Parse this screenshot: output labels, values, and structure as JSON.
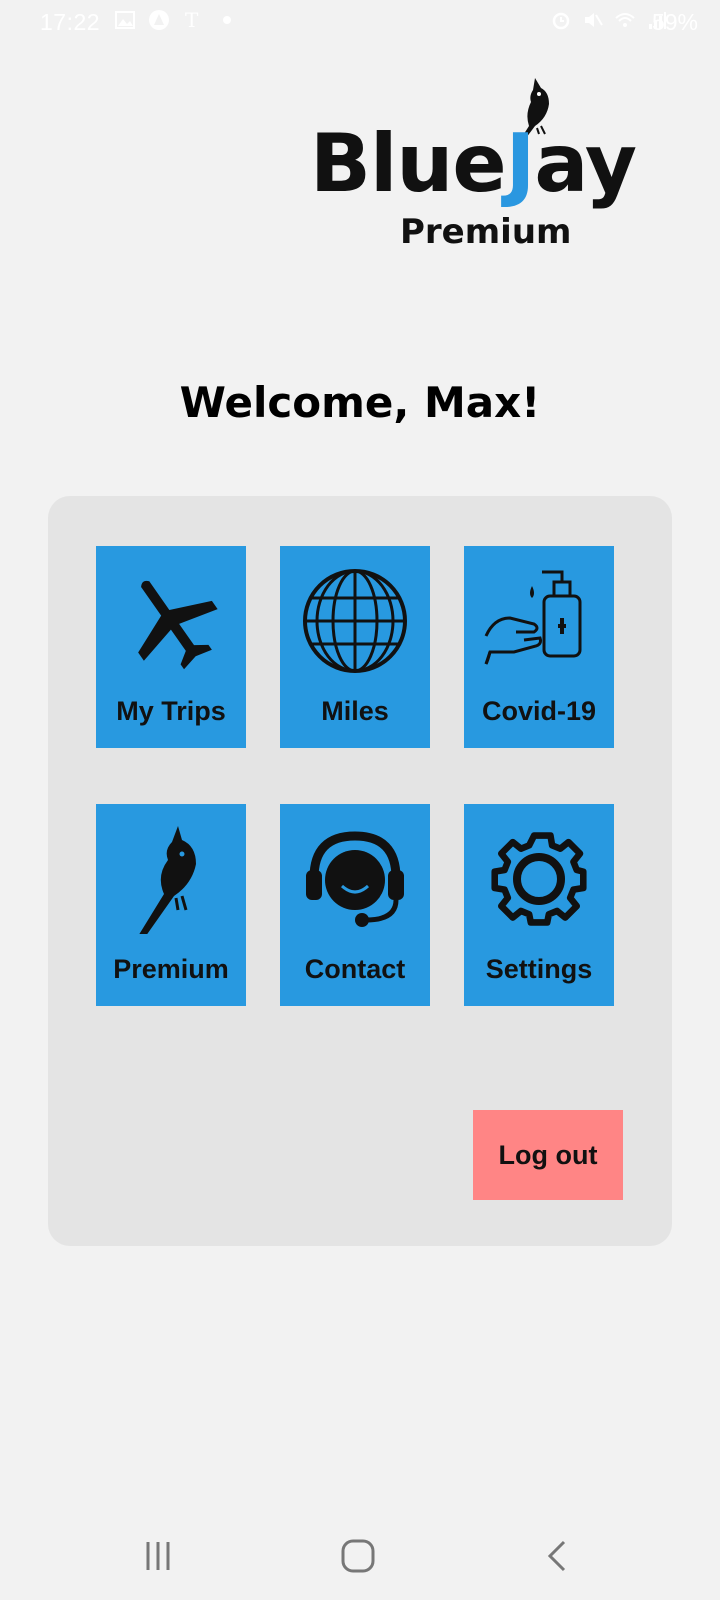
{
  "status_bar": {
    "time": "17:22",
    "battery": "59%",
    "left_icons": [
      "gallery-icon",
      "app-icon",
      "nytimes-icon",
      "dot-icon"
    ],
    "right_icons": [
      "alarm-icon",
      "mute-icon",
      "wifi-icon",
      "signal-icon",
      "battery-icon"
    ]
  },
  "logo": {
    "word_blue": "Blue",
    "word_jay_j": "J",
    "word_jay_rest": "ay",
    "subtitle": "Premium"
  },
  "welcome": "Welcome, Max!",
  "menu": {
    "tiles": [
      {
        "label": "My Trips",
        "icon": "airplane-icon"
      },
      {
        "label": "Miles",
        "icon": "globe-icon"
      },
      {
        "label": "Covid-19",
        "icon": "hand-sanitizer-icon"
      },
      {
        "label": "Premium",
        "icon": "bird-icon"
      },
      {
        "label": "Contact",
        "icon": "headset-icon"
      },
      {
        "label": "Settings",
        "icon": "gear-icon"
      }
    ],
    "logout_label": "Log out"
  },
  "colors": {
    "tile": "#2899e0",
    "logout": "#ff8585",
    "panel": "#e4e4e4",
    "background": "#f2f2f2"
  },
  "nav_bar": {
    "buttons": [
      "recent-apps-icon",
      "home-icon",
      "back-icon"
    ]
  }
}
